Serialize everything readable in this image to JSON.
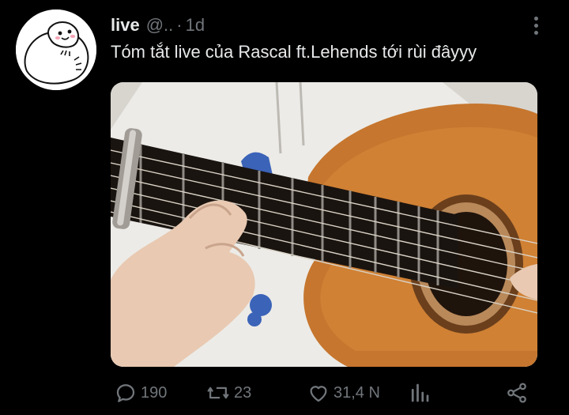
{
  "tweet": {
    "display_name": "live",
    "handle": "@..",
    "separator": "·",
    "timestamp": "1d",
    "text": "Tóm tắt live của Rascal ft.Lehends tới rùi đâyyy",
    "media_icons": {
      "avatar": "cartoon-face-avatar",
      "media": "guitar-video-thumbnail"
    }
  },
  "actions": {
    "reply_count": "190",
    "retweet_count": "23",
    "like_count": "31,4 N",
    "icons": [
      "reply-icon",
      "retweet-icon",
      "like-icon",
      "analytics-icon",
      "share-icon"
    ]
  },
  "colors": {
    "background": "#000000",
    "text_primary": "#e7e9ea",
    "text_secondary": "#71767b"
  }
}
